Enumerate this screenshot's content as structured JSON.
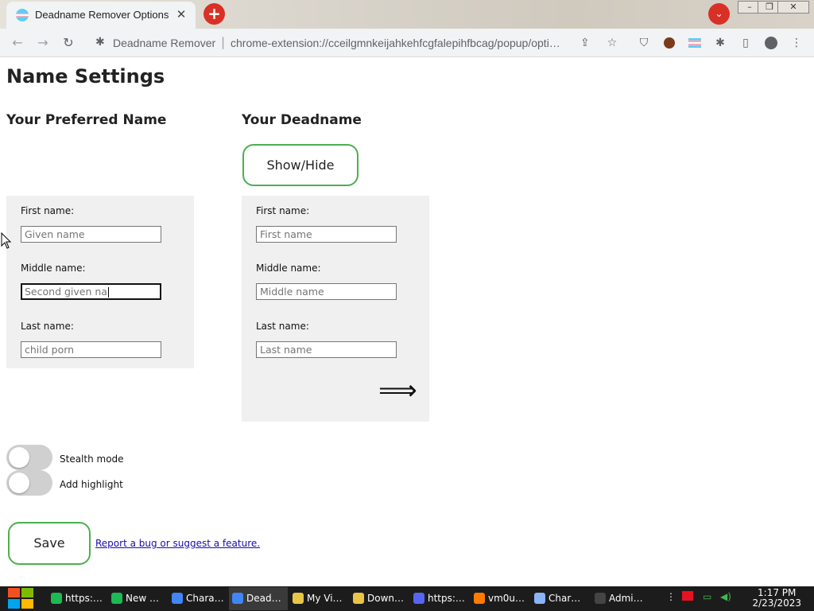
{
  "browser": {
    "tab_title": "Deadname Remover Options",
    "tab_close": "✕",
    "new_tab": "+",
    "omnibox_name": "Deadname Remover",
    "omnibox_sep": "|",
    "omnibox_url": "chrome-extension://cceilgmnkeijahkehfcgfalepihfbcag/popup/opti…"
  },
  "page": {
    "title": "Name Settings",
    "preferred_heading": "Your Preferred Name",
    "deadname_heading": "Your Deadname",
    "show_hide": "Show/Hide",
    "preferred": {
      "first_label": "First name:",
      "first_placeholder": "Given name",
      "middle_label": "Middle name:",
      "middle_value": "Second given na",
      "last_label": "Last name:",
      "last_placeholder": "child porn"
    },
    "deadname": {
      "first_label": "First name:",
      "first_placeholder": "First name",
      "middle_label": "Middle name:",
      "middle_placeholder": "Middle name",
      "last_label": "Last name:",
      "last_placeholder": "Last name",
      "arrow": "⟹"
    },
    "stealth_label": "Stealth mode",
    "stealth_on": false,
    "highlight_label": "Add highlight",
    "highlight_on": false,
    "save": "Save",
    "report_link": "Report a bug or suggest a feature."
  },
  "taskbar": {
    "tasks": [
      {
        "label": "https:…",
        "color": "#1db954"
      },
      {
        "label": "New …",
        "color": "#1db954"
      },
      {
        "label": "Chara…",
        "color": "#4285f4"
      },
      {
        "label": "Dead…",
        "color": "#4285f4"
      },
      {
        "label": "My Vi…",
        "color": "#e8c547"
      },
      {
        "label": "Down…",
        "color": "#e8c547"
      },
      {
        "label": "https:…",
        "color": "#5865f2"
      },
      {
        "label": "vm0u…",
        "color": "#ff7a00"
      },
      {
        "label": "Char…",
        "color": "#8ab4f8"
      },
      {
        "label": "Admi…",
        "color": "#444444"
      }
    ],
    "time": "1:17 PM",
    "date": "2/23/2023"
  },
  "colors": {
    "accent_green": "#4caf50",
    "panel_bg": "#f0f0f0",
    "chrome_red": "#d93025"
  }
}
